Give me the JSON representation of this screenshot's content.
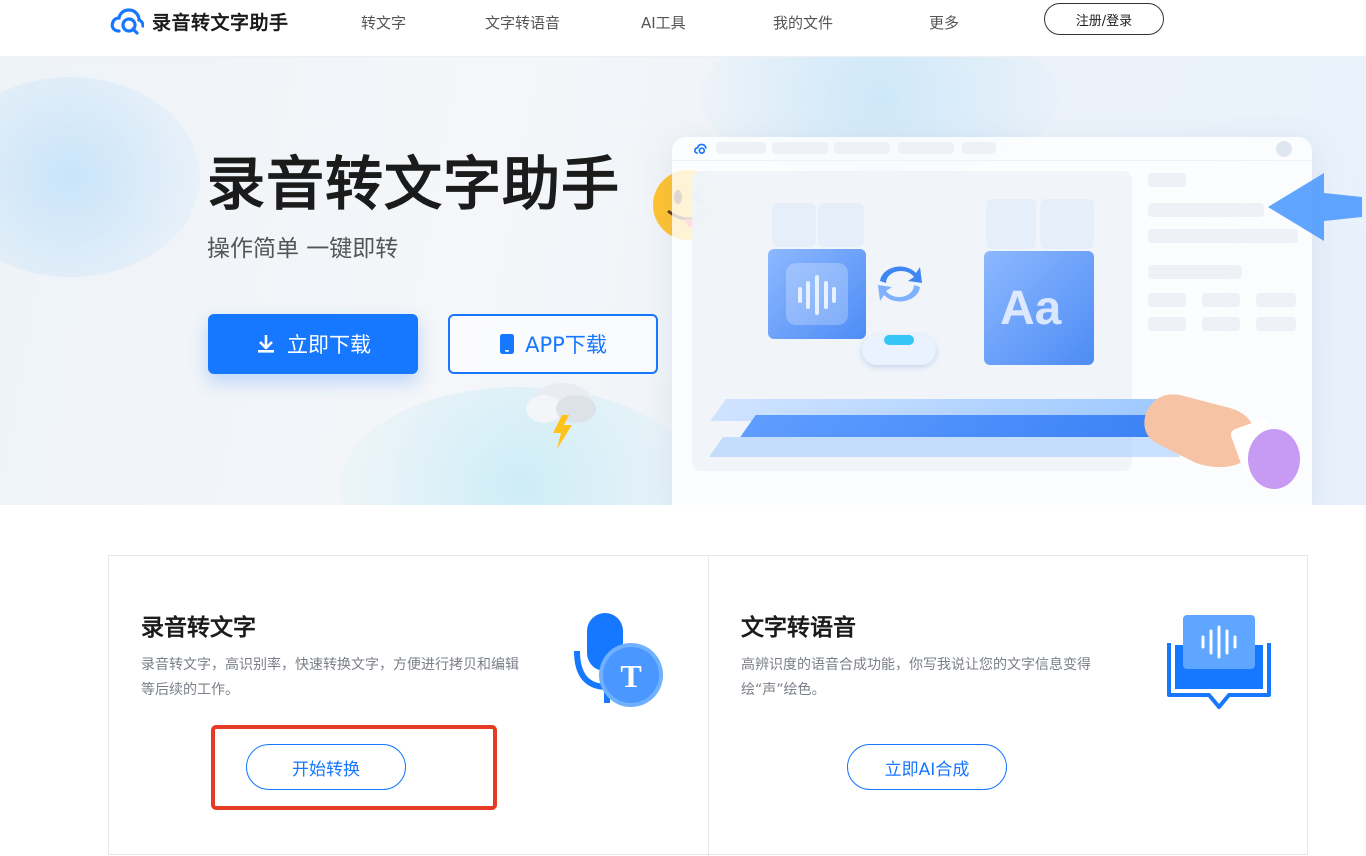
{
  "nav": {
    "logo_text": "录音转文字助手",
    "items": [
      {
        "label": "转文字"
      },
      {
        "label": "文字转语音"
      },
      {
        "label": "AI工具"
      },
      {
        "label": "我的文件"
      },
      {
        "label": "更多"
      }
    ],
    "login_label": "注册/登录"
  },
  "hero": {
    "title": "录音转文字助手",
    "subtitle": "操作简单 一键即转",
    "download_label": "立即下载",
    "app_download_label": "APP下载"
  },
  "cards": [
    {
      "title": "录音转文字",
      "description": "录音转文字，高识别率，快速转换文字，方便进行拷贝和编辑等后续的工作。",
      "button_label": "开始转换",
      "icon": "microphone-text-icon"
    },
    {
      "title": "文字转语音",
      "description": "高辨识度的语音合成功能，你写我说让您的文字信息变得绘“声”绘色。",
      "button_label": "立即AI合成",
      "icon": "voice-book-icon"
    }
  ],
  "colors": {
    "accent": "#1677ff",
    "highlight": "#e53b24"
  }
}
